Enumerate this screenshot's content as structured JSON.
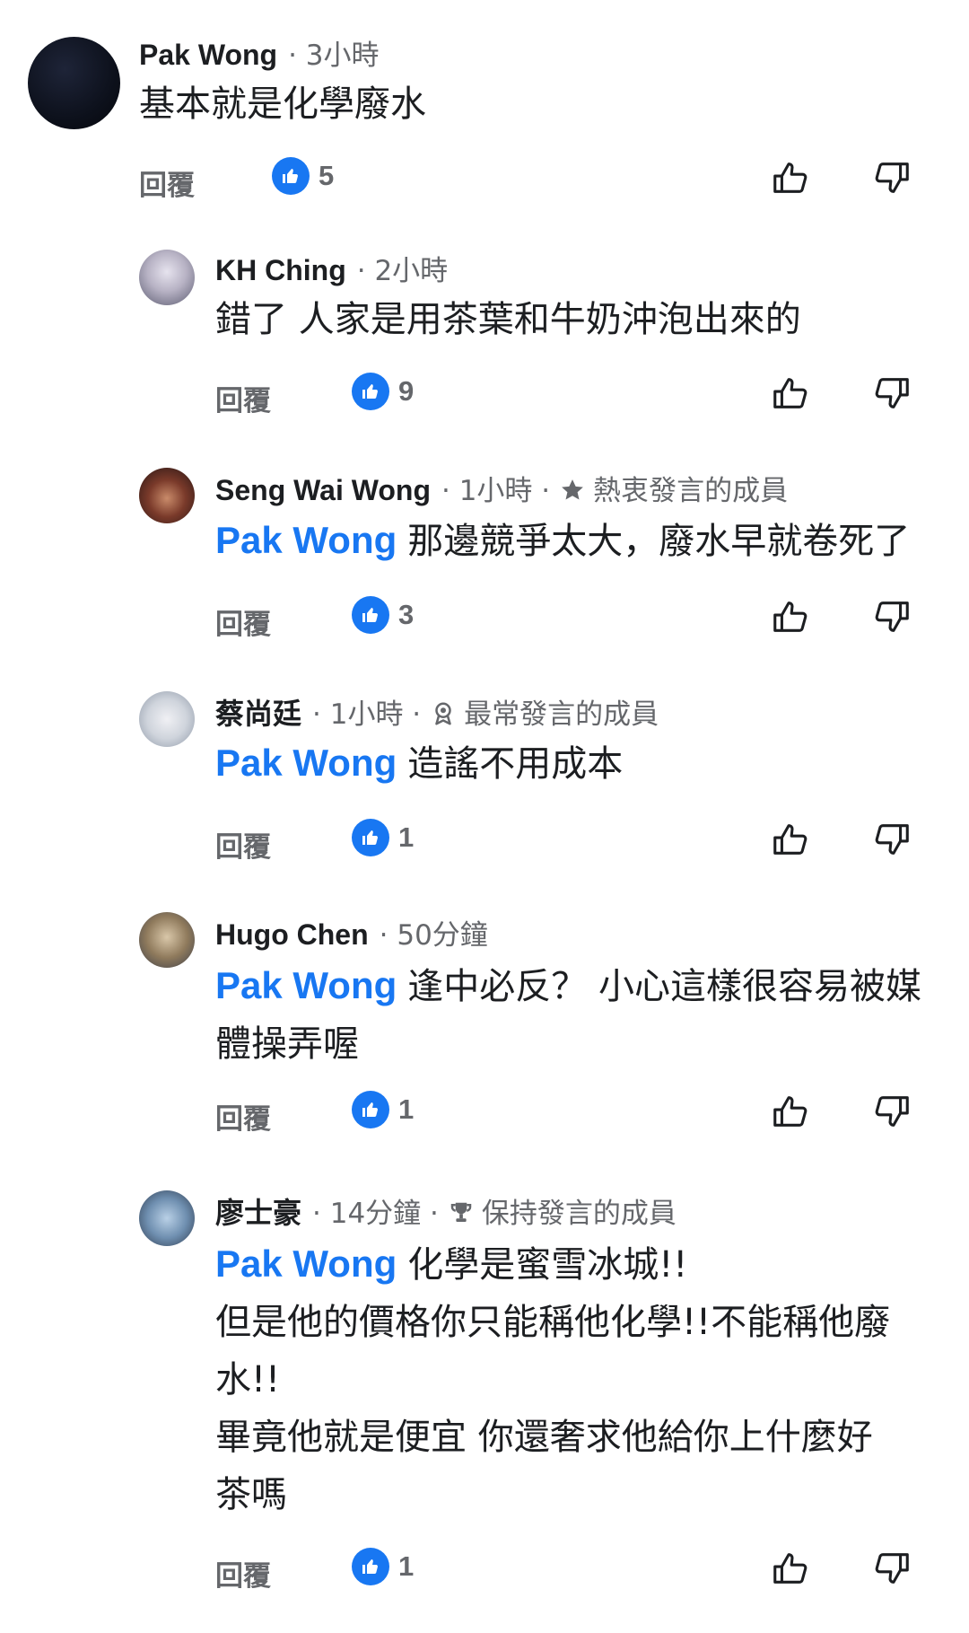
{
  "comments": [
    {
      "name": "Pak Wong",
      "time": "· 3小時",
      "text": "基本就是化學廢水",
      "reply_label": "回覆",
      "likes": "5"
    },
    {
      "name": "KH Ching",
      "time": "· 2小時",
      "text": "錯了 人家是用茶葉和牛奶沖泡出來的",
      "reply_label": "回覆",
      "likes": "9"
    },
    {
      "name": "Seng Wai Wong",
      "time": "· 1小時 ·",
      "badge": "熱衷發言的成員",
      "badge_icon": "star-icon",
      "mention": "Pak Wong",
      "text": "那邊競爭太大，廢水早就卷死了",
      "reply_label": "回覆",
      "likes": "3"
    },
    {
      "name": "蔡尚廷",
      "time": "· 1小時 ·",
      "badge": "最常發言的成員",
      "badge_icon": "award-icon",
      "mention": "Pak Wong",
      "text": "造謠不用成本",
      "reply_label": "回覆",
      "likes": "1"
    },
    {
      "name": "Hugo Chen",
      "time": "· 50分鐘",
      "mention": "Pak Wong",
      "text_line1": "逢中必反？ 小心這樣很容易被媒",
      "text_line2": "體操弄喔",
      "reply_label": "回覆",
      "likes": "1"
    },
    {
      "name": "廖士豪",
      "time": "· 14分鐘 ·",
      "badge": "保持發言的成員",
      "badge_icon": "trophy-icon",
      "mention": "Pak Wong",
      "text_line1": "化學是蜜雪冰城!!",
      "text_line2": "但是他的價格你只能稱他化學!!不能稱他廢",
      "text_line3": "水!!",
      "text_line4": "畢竟他就是便宜 你還奢求他給你上什麼好",
      "text_line5": "茶嗎",
      "reply_label": "回覆",
      "likes": "1"
    }
  ],
  "colors": {
    "accent": "#1877f2",
    "secondary_text": "#65676b",
    "primary_text": "#1c1e21"
  }
}
